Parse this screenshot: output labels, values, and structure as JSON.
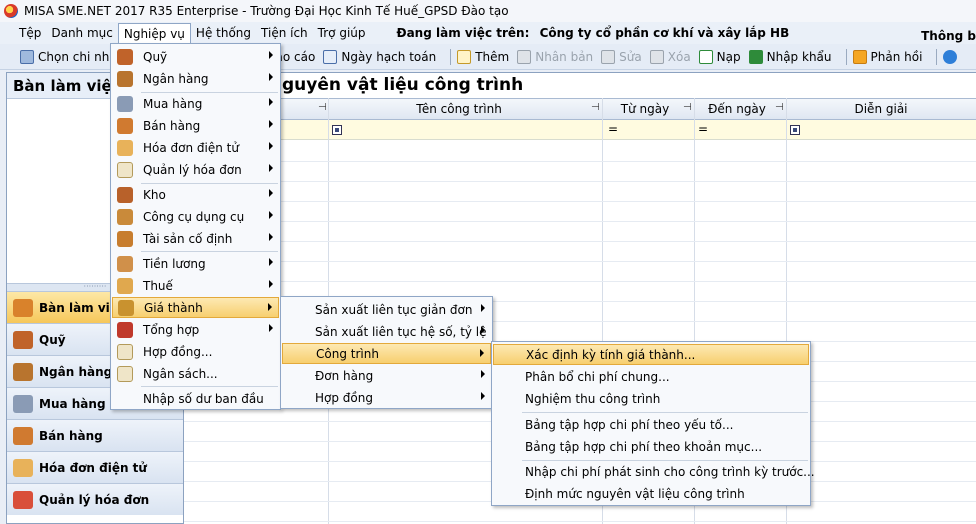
{
  "window": {
    "title": "MISA SME.NET 2017 R35 Enterprise - Trường Đại Học Kinh Tế Huế_GPSD Đào tạo"
  },
  "menubar": {
    "items": [
      "Tệp",
      "Danh mục",
      "Nghiệp vụ",
      "Hệ thống",
      "Tiện ích",
      "Trợ giúp"
    ],
    "working_label": "Đang làm việc trên:",
    "company": "Công ty cổ phần cơ khí và xây lắp HB",
    "notify": "Thông b"
  },
  "toolbar": {
    "items": [
      {
        "label": "Chọn chi nh",
        "icon": "document-icon",
        "disabled": false
      },
      {
        "label": "Báo cáo",
        "icon": "report-icon",
        "disabled": false
      },
      {
        "label": "Ngày hạch toán",
        "icon": "calendar-icon",
        "disabled": false
      },
      {
        "label": "Thêm",
        "icon": "add-icon",
        "disabled": false
      },
      {
        "label": "Nhân bản",
        "icon": "copy-icon",
        "disabled": true
      },
      {
        "label": "Sửa",
        "icon": "edit-icon",
        "disabled": true
      },
      {
        "label": "Xóa",
        "icon": "delete-icon",
        "disabled": true
      },
      {
        "label": "Nạp",
        "icon": "refresh-icon",
        "disabled": false
      },
      {
        "label": "Nhập khẩu",
        "icon": "excel-icon",
        "disabled": false
      },
      {
        "label": "Phản hồi",
        "icon": "mail-icon",
        "disabled": false
      }
    ]
  },
  "left_panel": {
    "title": "Bàn làm việc",
    "nav": [
      "Bàn làm việc",
      "Quỹ",
      "Ngân hàng",
      "Mua hàng",
      "Bán hàng",
      "Hóa đơn điện tử",
      "Quản lý hóa đơn"
    ]
  },
  "main": {
    "title": "Định mức nguyên vật liệu công trình",
    "visible_title": "guyên vật liệu công trình",
    "columns": [
      "Tên công trình",
      "Từ ngày",
      "Đến ngày",
      "Diễn giải"
    ],
    "filter_eq": "="
  },
  "menu_nghiep_vu": [
    "Quỹ",
    "Ngân hàng",
    "Mua hàng",
    "Bán hàng",
    "Hóa đơn điện tử",
    "Quản lý hóa đơn",
    "Kho",
    "Công cụ dụng cụ",
    "Tài sản cố định",
    "Tiền lương",
    "Thuế",
    "Giá thành",
    "Tổng hợp",
    "Hợp đồng...",
    "Ngân sách...",
    "Nhập số dư ban đầu"
  ],
  "menu_gia_thanh": [
    "Sản xuất liên tục giản đơn",
    "Sản xuất liên tục hệ số, tỷ lệ",
    "Công trình",
    "Đơn hàng",
    "Hợp đồng"
  ],
  "menu_cong_trinh": [
    "Xác định kỳ tính giá thành...",
    "Phân bổ chi phí chung...",
    "Nghiệm thu công trình",
    "Bảng tập hợp chi phí theo yếu tố...",
    "Bảng tập hợp chi phí theo khoản mục...",
    "Nhập chi phí phát sinh cho công trình kỳ trước...",
    "Định mức nguyên vật liệu công trình"
  ],
  "colors": {
    "highlight": "#f7cf6f",
    "accent": "#1b63c6"
  }
}
